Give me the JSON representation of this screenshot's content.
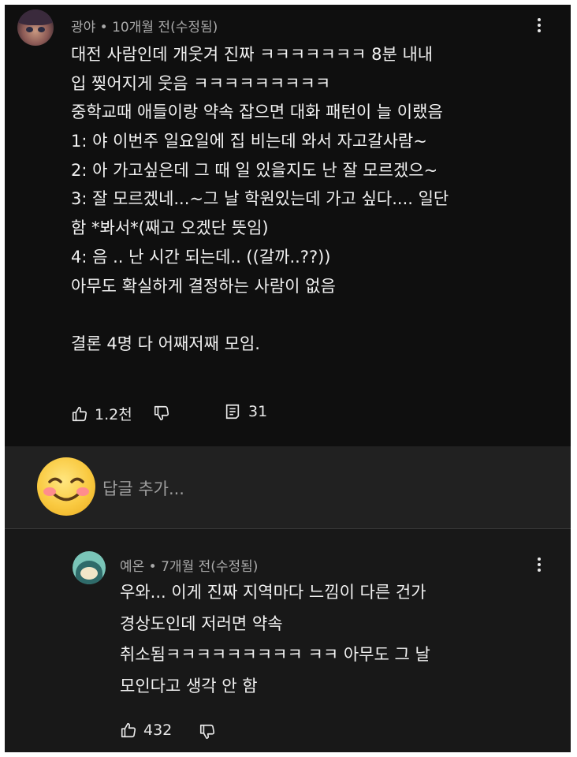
{
  "comment": {
    "author": "광야",
    "meta_suffix": " • 10개월 전(수정됨)",
    "lines": [
      "대전 사람인데 개웃겨 진짜 ㅋㅋㅋㅋㅋㅋㅋ 8분 내내",
      "입 찢어지게 웃음 ㅋㅋㅋㅋㅋㅋㅋㅋㅋ",
      "중학교때 애들이랑 약속 잡으면 대화 패턴이 늘 이랬음",
      "1: 야 이번주 일요일에 집 비는데 와서 자고갈사람~",
      "2: 아 가고싶은데 그 때 일 있을지도 난 잘 모르겠으~",
      "3: 잘 모르겠네...~그 날 학원있는데 가고 싶다.... 일단",
      "함 *봐서*(째고 오겠단 뜻임)",
      "4: 음 .. 난 시간 되는데.. ((갈까..??))",
      "아무도 확실하게 결정하는 사람이 없음",
      "",
      "결론 4명 다 어째저째 모임."
    ],
    "likes": "1.2천",
    "replies": "31"
  },
  "reply_box": {
    "placeholder": "답글 추가..."
  },
  "reply": {
    "author": "예온",
    "meta_suffix": " • 7개월 전(수정됨)",
    "lines": [
      "우와... 이게 진짜 지역마다 느낌이 다른 건가",
      "경상도인데 저러면 약속",
      "취소됨ㅋㅋㅋㅋㅋㅋㅋㅋㅋ ㅋㅋ 아무도 그 날",
      "모인다고 생각 안 함"
    ],
    "likes": "432"
  },
  "icons": {
    "like": "thumbs-up-icon",
    "dislike": "thumbs-down-icon",
    "replies": "reply-comment-icon",
    "menu": "more-vertical-icon"
  },
  "colors": {
    "background": "#0f0f0f",
    "reply_bar": "#212121",
    "reply_section": "#181818",
    "text": "#f1f1f1",
    "meta": "#aaaaaa",
    "placeholder": "#9e9e9e"
  }
}
